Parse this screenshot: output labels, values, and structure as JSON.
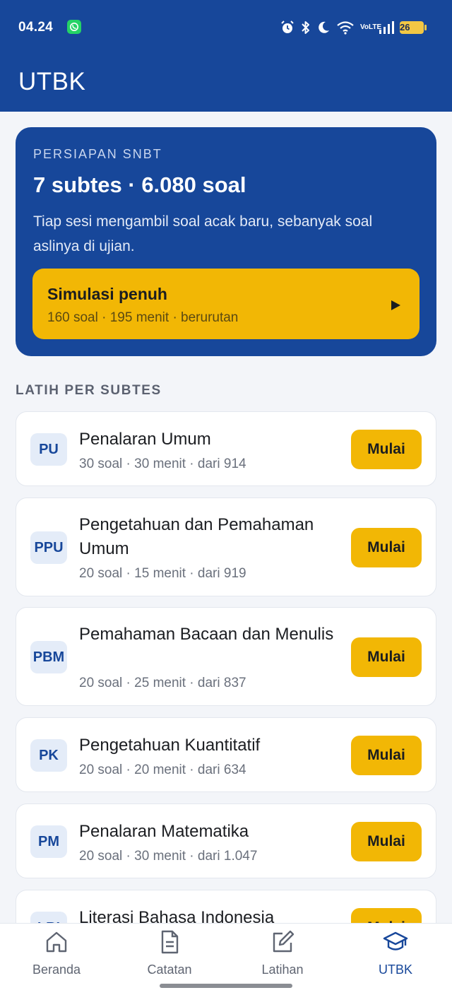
{
  "status_bar": {
    "time": "04.24",
    "volte_top": "Vo",
    "volte_bottom": "LTE",
    "battery": "26"
  },
  "header": {
    "title": "UTBK"
  },
  "hero": {
    "eyebrow": "PERSIAPAN SNBT",
    "title": "7 subtes · 6.080 soal",
    "description": "Tiap sesi mengambil soal acak baru, sebanyak soal aslinya di ujian.",
    "simulation": {
      "title": "Simulasi penuh",
      "subtitle": "160 soal · 195 menit · berurutan"
    }
  },
  "section_label": "LATIH PER SUBTES",
  "start_label": "Mulai",
  "subtests": [
    {
      "code": "PU",
      "title": "Penalaran Umum",
      "meta": "30 soal · 30 menit · dari 914"
    },
    {
      "code": "PPU",
      "title": "Pengetahuan dan Pemahaman Umum",
      "meta": "20 soal · 15 menit · dari 919"
    },
    {
      "code": "PBM",
      "title": "Pemahaman Bacaan dan Menulis",
      "meta": "20 soal · 25 menit · dari 837"
    },
    {
      "code": "PK",
      "title": "Pengetahuan Kuantitatif",
      "meta": "20 soal · 20 menit · dari 634"
    },
    {
      "code": "PM",
      "title": "Penalaran Matematika",
      "meta": "20 soal · 30 menit · dari 1.047"
    },
    {
      "code": "LBI",
      "title": "Literasi Bahasa Indonesia",
      "meta": ""
    }
  ],
  "bottom_nav": [
    {
      "label": "Beranda",
      "icon": "home-icon"
    },
    {
      "label": "Catatan",
      "icon": "document-icon"
    },
    {
      "label": "Latihan",
      "icon": "edit-icon"
    },
    {
      "label": "UTBK",
      "icon": "graduation-cap-icon",
      "active": true
    }
  ],
  "colors": {
    "primary": "#17479a",
    "accent": "#f2b705",
    "background": "#f3f5f9"
  }
}
